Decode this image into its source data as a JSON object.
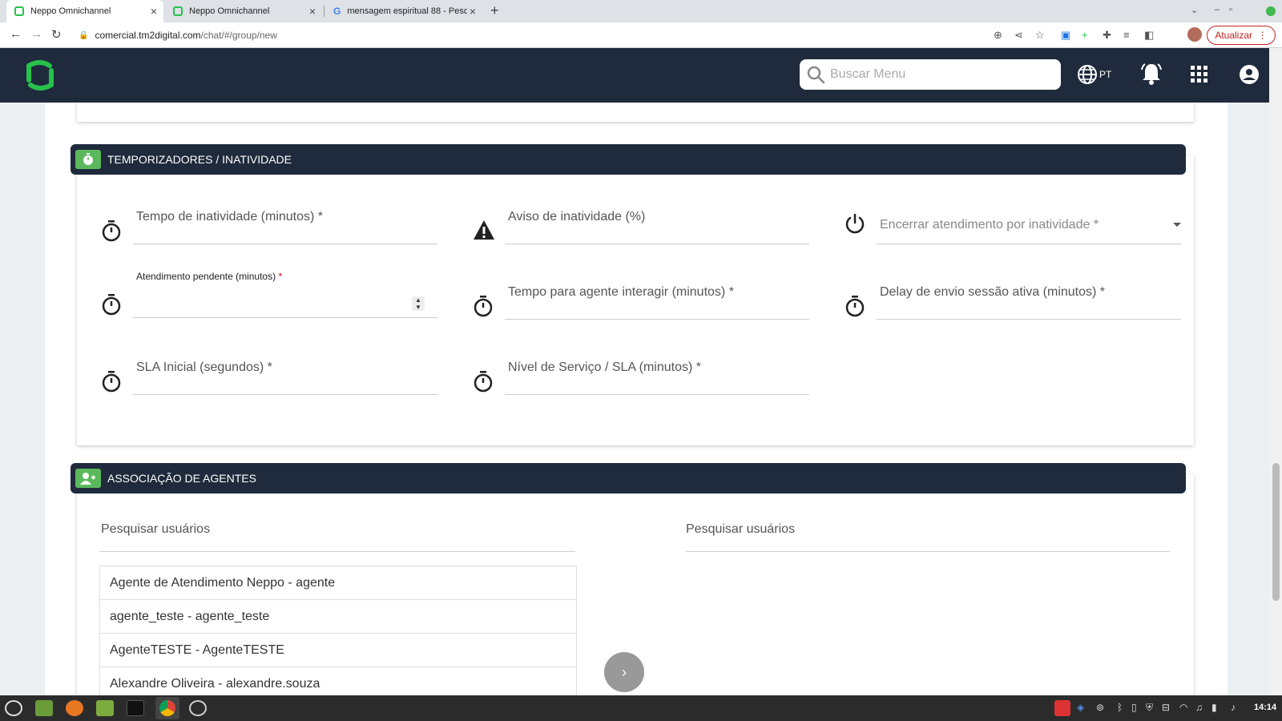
{
  "browser": {
    "tabs": [
      {
        "title": "Neppo Omnichannel",
        "active": true
      },
      {
        "title": "Neppo Omnichannel",
        "active": false
      },
      {
        "title": "mensagem espiritual 88 - Pesq",
        "active": false
      }
    ],
    "new_tab": "+",
    "url_host": "comercial.tm2digital.com",
    "url_path": "/chat/#/group/new",
    "update_label": "Atualizar",
    "update_menu": "⋮"
  },
  "header": {
    "search_placeholder": "Buscar Menu",
    "language": "PT",
    "brand_color": "#1f2a3c",
    "accent_color": "#27c24c"
  },
  "timers_section": {
    "title": "TEMPORIZADORES / INATIVIDADE",
    "fields": {
      "inactivity_time": {
        "label": "Tempo de inatividade (minutos) *",
        "icon": "timer-icon"
      },
      "inactivity_warning": {
        "label": "Aviso de inatividade (%)",
        "icon": "warning-icon"
      },
      "end_by_inactivity": {
        "label": "Encerrar atendimento por inatividade *",
        "icon": "power-icon"
      },
      "pending_attendance": {
        "label": "Atendimento pendente (minutos)",
        "required_mark": "*",
        "icon": "timer-icon"
      },
      "agent_interact_time": {
        "label": "Tempo para agente interagir (minutos) *",
        "icon": "timer-icon"
      },
      "active_session_delay": {
        "label": "Delay de envio sessão ativa (minutos) *",
        "icon": "timer-icon"
      },
      "initial_sla": {
        "label": "SLA Inicial (segundos) *",
        "icon": "timer-icon"
      },
      "service_level": {
        "label": "Nível de Serviço / SLA (minutos) *",
        "icon": "timer-icon"
      }
    }
  },
  "agents_section": {
    "title": "ASSOCIAÇÃO DE AGENTES",
    "search_left": "Pesquisar usuários",
    "search_right": "Pesquisar usuários",
    "available_agents": [
      "Agente de Atendimento Neppo - agente",
      "agente_teste - agente_teste",
      "AgenteTESTE - AgenteTESTE",
      "Alexandre Oliveira - alexandre.souza"
    ],
    "move_button": "›"
  },
  "taskbar": {
    "clock": "14:14"
  }
}
